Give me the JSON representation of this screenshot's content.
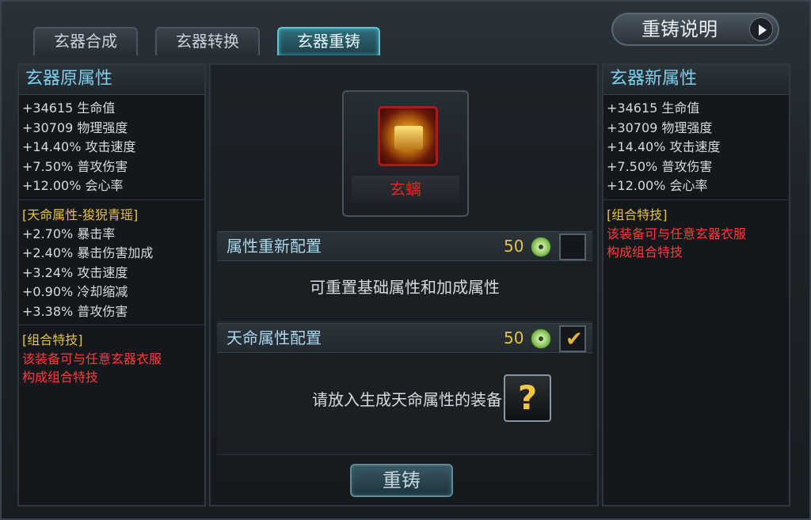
{
  "tabs": [
    {
      "label": "玄器合成"
    },
    {
      "label": "玄器转换"
    },
    {
      "label": "玄器重铸"
    }
  ],
  "active_tab": "玄器重铸",
  "explain_button": {
    "label": "重铸说明"
  },
  "left_panel": {
    "title": "玄器原属性",
    "base_attrs": [
      "+34615 生命值",
      "+30709 物理强度",
      "+14.40% 攻击速度",
      "+7.50% 普攻伤害",
      "+12.00% 会心率"
    ],
    "fate_title": "[天命属性-狻猊青瑶]",
    "fate_attrs": [
      "+2.70% 暴击率",
      "+2.40% 暴击伤害加成",
      "+3.24% 攻击速度",
      "+0.90% 冷却缩减",
      "+3.38% 普攻伤害"
    ],
    "combo_title": "[组合特技]",
    "combo_lines": [
      "该装备可与任意玄器衣服",
      "构成组合特技"
    ]
  },
  "right_panel": {
    "title": "玄器新属性",
    "base_attrs": [
      "+34615 生命值",
      "+30709 物理强度",
      "+14.40% 攻击速度",
      "+7.50% 普攻伤害",
      "+12.00% 会心率"
    ],
    "combo_title": "[组合特技]",
    "combo_lines": [
      "该装备可与任意玄器衣服",
      "构成组合特技"
    ]
  },
  "center": {
    "item_name": "玄螭",
    "option1": {
      "label": "属性重新配置",
      "cost": "50",
      "checked": false
    },
    "option1_desc": "可重置基础属性和加成属性",
    "option2": {
      "label": "天命属性配置",
      "cost": "50",
      "checked": true
    },
    "option2_desc": "请放入生成天命属性的装备",
    "help_glyph": "?",
    "checkmark_glyph": "✔",
    "recast_button": "重铸"
  },
  "icons": [
    "jade-coin-icon",
    "checkbox-icon",
    "help-icon",
    "play-arrow-icon",
    "relic-item-icon"
  ],
  "colors": {
    "accent": "#7fd0ec",
    "gold": "#e6c14a",
    "red": "#ff3a3a",
    "item_name": "#e02626"
  }
}
